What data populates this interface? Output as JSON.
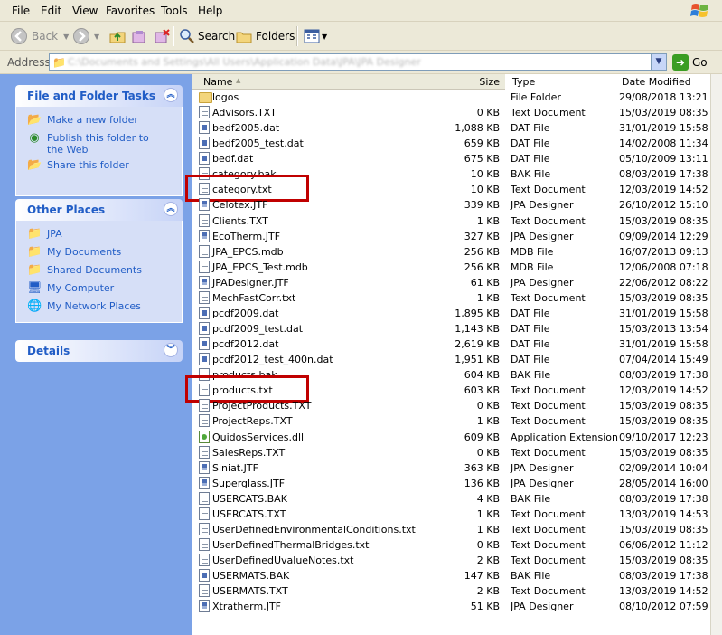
{
  "menu": [
    "File",
    "Edit",
    "View",
    "Favorites",
    "Tools",
    "Help"
  ],
  "toolbar": {
    "back_label": "Back",
    "search_label": "Search",
    "folders_label": "Folders"
  },
  "address": {
    "label": "Address",
    "path": "C:\\Documents and Settings\\All Users\\Application Data\\JPA\\JPA Designer",
    "go_label": "Go"
  },
  "tasks_panels": [
    {
      "title": "File and Folder Tasks",
      "items": [
        {
          "label": "Make a new folder",
          "icon": "new-folder-icon"
        },
        {
          "label": "Publish this folder to the Web",
          "icon": "publish-web-icon"
        },
        {
          "label": "Share this folder",
          "icon": "share-folder-icon"
        }
      ]
    },
    {
      "title": "Other Places",
      "items": [
        {
          "label": "JPA",
          "icon": "folder-icon"
        },
        {
          "label": "My Documents",
          "icon": "my-documents-icon"
        },
        {
          "label": "Shared Documents",
          "icon": "shared-documents-icon"
        },
        {
          "label": "My Computer",
          "icon": "my-computer-icon"
        },
        {
          "label": "My Network Places",
          "icon": "network-places-icon"
        }
      ]
    },
    {
      "title": "Details",
      "items": []
    }
  ],
  "columns": {
    "name": "Name",
    "size": "Size",
    "type": "Type",
    "date": "Date Modified"
  },
  "files": [
    {
      "name": "logos",
      "size": "",
      "type": "File Folder",
      "date": "29/08/2018 13:21",
      "icon": "folder"
    },
    {
      "name": "Advisors.TXT",
      "size": "0 KB",
      "type": "Text Document",
      "date": "15/03/2019 08:35",
      "icon": "txt"
    },
    {
      "name": "bedf2005.dat",
      "size": "1,088 KB",
      "type": "DAT File",
      "date": "31/01/2019 15:58",
      "icon": "dat"
    },
    {
      "name": "bedf2005_test.dat",
      "size": "659 KB",
      "type": "DAT File",
      "date": "14/02/2008 11:34",
      "icon": "dat"
    },
    {
      "name": "bedf.dat",
      "size": "675 KB",
      "type": "DAT File",
      "date": "05/10/2009 13:11",
      "icon": "dat"
    },
    {
      "name": "category.bak",
      "size": "10 KB",
      "type": "BAK File",
      "date": "08/03/2019 17:38",
      "icon": "txt"
    },
    {
      "name": "category.txt",
      "size": "10 KB",
      "type": "Text Document",
      "date": "12/03/2019 14:52",
      "icon": "txt"
    },
    {
      "name": "Celotex.JTF",
      "size": "339 KB",
      "type": "JPA Designer",
      "date": "26/10/2012 15:10",
      "icon": "jtf"
    },
    {
      "name": "Clients.TXT",
      "size": "1 KB",
      "type": "Text Document",
      "date": "15/03/2019 08:35",
      "icon": "txt"
    },
    {
      "name": "EcoTherm.JTF",
      "size": "327 KB",
      "type": "JPA Designer",
      "date": "09/09/2014 12:29",
      "icon": "jtf"
    },
    {
      "name": "JPA_EPCS.mdb",
      "size": "256 KB",
      "type": "MDB File",
      "date": "16/07/2013 09:13",
      "icon": "txt"
    },
    {
      "name": "JPA_EPCS_Test.mdb",
      "size": "256 KB",
      "type": "MDB File",
      "date": "12/06/2008 07:18",
      "icon": "txt"
    },
    {
      "name": "JPADesigner.JTF",
      "size": "61 KB",
      "type": "JPA Designer",
      "date": "22/06/2012 08:22",
      "icon": "jtf"
    },
    {
      "name": "MechFastCorr.txt",
      "size": "1 KB",
      "type": "Text Document",
      "date": "15/03/2019 08:35",
      "icon": "txt"
    },
    {
      "name": "pcdf2009.dat",
      "size": "1,895 KB",
      "type": "DAT File",
      "date": "31/01/2019 15:58",
      "icon": "dat"
    },
    {
      "name": "pcdf2009_test.dat",
      "size": "1,143 KB",
      "type": "DAT File",
      "date": "15/03/2013 13:54",
      "icon": "dat"
    },
    {
      "name": "pcdf2012.dat",
      "size": "2,619 KB",
      "type": "DAT File",
      "date": "31/01/2019 15:58",
      "icon": "dat"
    },
    {
      "name": "pcdf2012_test_400n.dat",
      "size": "1,951 KB",
      "type": "DAT File",
      "date": "07/04/2014 15:49",
      "icon": "dat"
    },
    {
      "name": "products.bak",
      "size": "604 KB",
      "type": "BAK File",
      "date": "08/03/2019 17:38",
      "icon": "txt"
    },
    {
      "name": "products.txt",
      "size": "603 KB",
      "type": "Text Document",
      "date": "12/03/2019 14:52",
      "icon": "txt"
    },
    {
      "name": "ProjectProducts.TXT",
      "size": "0 KB",
      "type": "Text Document",
      "date": "15/03/2019 08:35",
      "icon": "txt"
    },
    {
      "name": "ProjectReps.TXT",
      "size": "1 KB",
      "type": "Text Document",
      "date": "15/03/2019 08:35",
      "icon": "txt"
    },
    {
      "name": "QuidosServices.dll",
      "size": "609 KB",
      "type": "Application Extension",
      "date": "09/10/2017 12:23",
      "icon": "dll"
    },
    {
      "name": "SalesReps.TXT",
      "size": "0 KB",
      "type": "Text Document",
      "date": "15/03/2019 08:35",
      "icon": "txt"
    },
    {
      "name": "Siniat.JTF",
      "size": "363 KB",
      "type": "JPA Designer",
      "date": "02/09/2014 10:04",
      "icon": "jtf"
    },
    {
      "name": "Superglass.JTF",
      "size": "136 KB",
      "type": "JPA Designer",
      "date": "28/05/2014 16:00",
      "icon": "jtf"
    },
    {
      "name": "USERCATS.BAK",
      "size": "4 KB",
      "type": "BAK File",
      "date": "08/03/2019 17:38",
      "icon": "txt"
    },
    {
      "name": "USERCATS.TXT",
      "size": "1 KB",
      "type": "Text Document",
      "date": "13/03/2019 14:53",
      "icon": "txt"
    },
    {
      "name": "UserDefinedEnvironmentalConditions.txt",
      "size": "1 KB",
      "type": "Text Document",
      "date": "15/03/2019 08:35",
      "icon": "txt"
    },
    {
      "name": "UserDefinedThermalBridges.txt",
      "size": "0 KB",
      "type": "Text Document",
      "date": "06/06/2012 11:12",
      "icon": "txt"
    },
    {
      "name": "UserDefinedUvalueNotes.txt",
      "size": "2 KB",
      "type": "Text Document",
      "date": "15/03/2019 08:35",
      "icon": "txt"
    },
    {
      "name": "USERMATS.BAK",
      "size": "147 KB",
      "type": "BAK File",
      "date": "08/03/2019 17:38",
      "icon": "dat"
    },
    {
      "name": "USERMATS.TXT",
      "size": "2 KB",
      "type": "Text Document",
      "date": "13/03/2019 14:52",
      "icon": "txt"
    },
    {
      "name": "Xtratherm.JTF",
      "size": "51 KB",
      "type": "JPA Designer",
      "date": "08/10/2012 07:59",
      "icon": "jtf"
    }
  ],
  "highlighted_files": [
    "category.txt",
    "products.txt"
  ],
  "colors": {
    "highlight": "#C00000",
    "task_pane": "#7BA2E7",
    "link": "#215DC6"
  }
}
